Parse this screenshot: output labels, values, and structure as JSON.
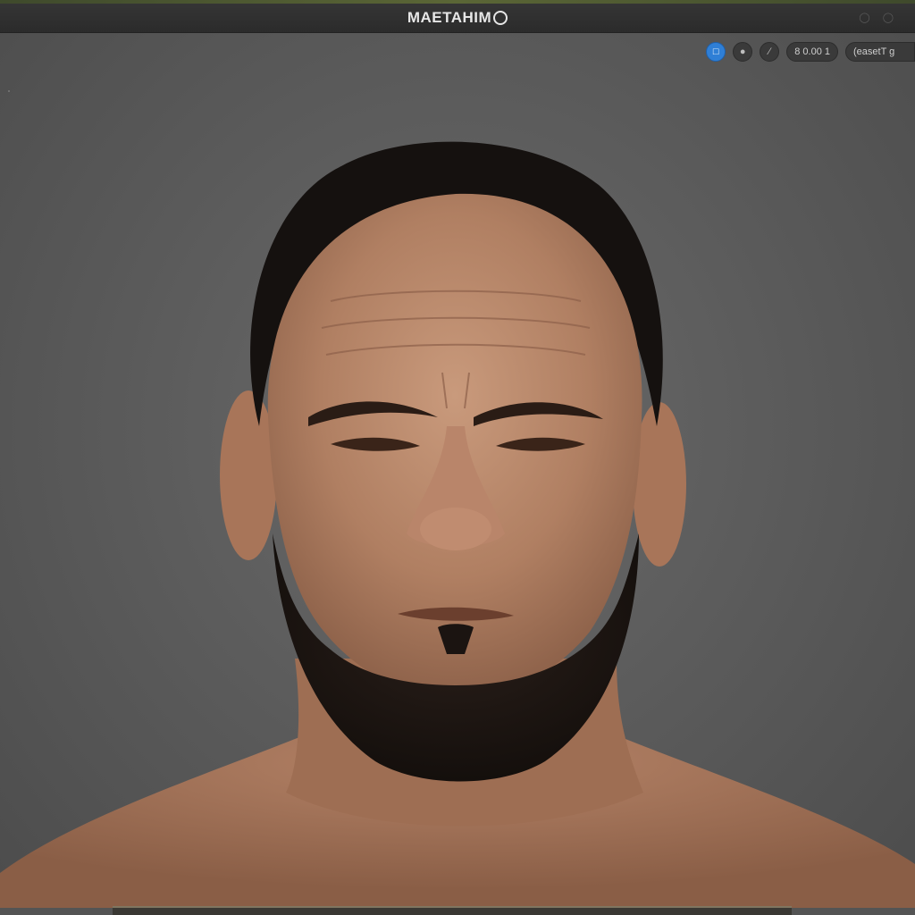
{
  "window": {
    "title": "MAETAHIM",
    "logo_icon": "app-logo-icon",
    "controls": [
      "minimize-icon",
      "maximize-icon"
    ]
  },
  "toolbar": {
    "buttons": [
      {
        "icon": "chat-icon",
        "active": true
      },
      {
        "icon": "globe-icon",
        "active": false
      },
      {
        "icon": "wand-icon",
        "active": false
      }
    ],
    "zoom_label": "8 0.00 1",
    "preset_label": "(easetT g"
  },
  "viewport": {
    "subject_icon": "head-model-icon"
  },
  "colors": {
    "accent": "#2f7fd6",
    "background": "#5e5e5e",
    "titlebar": "#2e2e2e"
  }
}
